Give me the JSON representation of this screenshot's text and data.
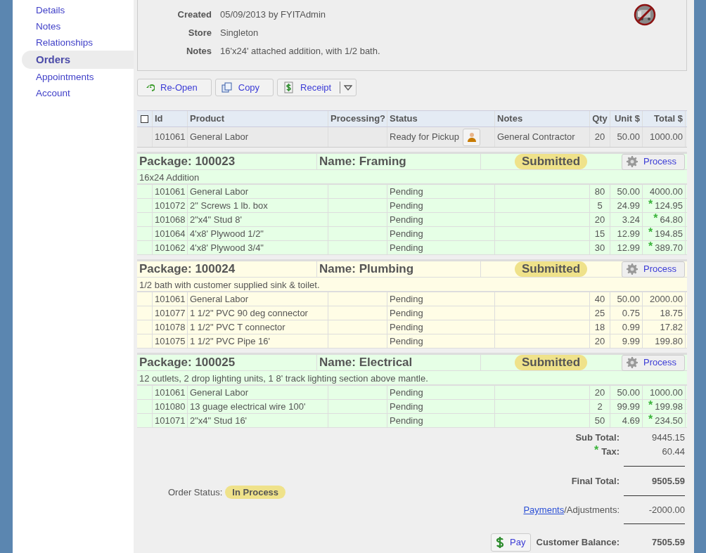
{
  "sidebar": {
    "items": [
      {
        "label": "Details",
        "selected": false
      },
      {
        "label": "Notes",
        "selected": false
      },
      {
        "label": "Relationships",
        "selected": false
      },
      {
        "label": "Orders",
        "selected": true
      },
      {
        "label": "Appointments",
        "selected": false
      },
      {
        "label": "Account",
        "selected": false
      }
    ]
  },
  "header": {
    "fields": [
      {
        "label": "Created",
        "value": "05/09/2013 by FYITAdmin"
      },
      {
        "label": "Store",
        "value": "Singleton"
      },
      {
        "label": "Notes",
        "value": "16'x24' attached addition, with 1/2 bath."
      }
    ]
  },
  "toolbar": [
    {
      "label": "Re-Open",
      "kind": "reopen"
    },
    {
      "label": "Copy",
      "kind": "copy"
    },
    {
      "label": "Receipt",
      "kind": "receipt"
    }
  ],
  "table": {
    "columns": [
      "Id",
      "Product",
      "Processing?",
      "Status",
      "Notes",
      "Qty",
      "Unit $",
      "Total $"
    ],
    "select_all": {
      "checked": false
    },
    "rows": [
      {
        "id": "101061",
        "product": "General Labor",
        "status": "Ready for Pickup",
        "notes": "General Contractor",
        "qty": "20",
        "unit": "50.00",
        "total": "1000.00"
      }
    ]
  },
  "packages": [
    {
      "package": "Package: 100023",
      "name": "Name: Framing",
      "status": "Submitted",
      "action": "Process",
      "description": "16x24 Addition",
      "color": "#e6ffe6",
      "rows": [
        {
          "id": "101061",
          "product": "General Labor",
          "status": "Pending",
          "qty": "80",
          "unit": "50.00",
          "total": "4000.00"
        },
        {
          "id": "101072",
          "product": "2\" Screws 1 lb. box",
          "status": "Pending",
          "qty": "5",
          "unit": "24.99",
          "total": "124.95",
          "mark": "*"
        },
        {
          "id": "101068",
          "product": "2\"x4\" Stud 8'",
          "status": "Pending",
          "qty": "20",
          "unit": "3.24",
          "total": "64.80",
          "mark": "*"
        },
        {
          "id": "101064",
          "product": "4'x8' Plywood 1/2\"",
          "status": "Pending",
          "qty": "15",
          "unit": "12.99",
          "total": "194.85",
          "mark": "*"
        },
        {
          "id": "101062",
          "product": "4'x8' Plywood 3/4\"",
          "status": "Pending",
          "qty": "30",
          "unit": "12.99",
          "total": "389.70",
          "mark": "*"
        }
      ]
    },
    {
      "package": "Package: 100024",
      "name": "Name: Plumbing",
      "status": "Submitted",
      "action": "Process",
      "description": "1/2 bath with customer supplied sink & toilet.",
      "color": "#fffde6",
      "rows": [
        {
          "id": "101061",
          "product": "General Labor",
          "status": "Pending",
          "qty": "40",
          "unit": "50.00",
          "total": "2000.00"
        },
        {
          "id": "101077",
          "product": "1 1/2\" PVC 90 deg connector",
          "status": "Pending",
          "qty": "25",
          "unit": "0.75",
          "total": "18.75"
        },
        {
          "id": "101078",
          "product": "1 1/2\" PVC T connector",
          "status": "Pending",
          "qty": "18",
          "unit": "0.99",
          "total": "17.82"
        },
        {
          "id": "101075",
          "product": "1 1/2\" PVC Pipe 16'",
          "status": "Pending",
          "qty": "20",
          "unit": "9.99",
          "total": "199.80"
        }
      ]
    },
    {
      "package": "Package: 100025",
      "name": "Name: Electrical",
      "status": "Submitted",
      "action": "Process",
      "description": "12 outlets, 2 drop lighting units, 1 8' track lighting section above mantle.",
      "color": "#e6ffe6",
      "rows": [
        {
          "id": "101061",
          "product": "General Labor",
          "status": "Pending",
          "qty": "20",
          "unit": "50.00",
          "total": "1000.00"
        },
        {
          "id": "101080",
          "product": "13 guage electrical wire 100'",
          "status": "Pending",
          "qty": "2",
          "unit": "99.99",
          "total": "199.98",
          "mark": "*"
        },
        {
          "id": "101071",
          "product": "2\"x4\" Stud 16'",
          "status": "Pending",
          "qty": "50",
          "unit": "4.69",
          "total": "234.50",
          "mark": "*"
        }
      ]
    }
  ],
  "totals": {
    "sub_total_label": "Sub Total:",
    "sub_total": "9445.15",
    "tax_label": "Tax:",
    "tax": "60.44",
    "tax_mark": "*",
    "final_total_label": "Final Total:",
    "final_total": "9505.59",
    "order_status_label": "Order Status:",
    "order_status": "In Process",
    "payments_link": "Payments",
    "adjustments_label": "/Adjustments:",
    "adjustments": "-2000.00",
    "pay_button": "Pay",
    "balance_label": "Customer Balance:",
    "balance": "7505.59"
  }
}
